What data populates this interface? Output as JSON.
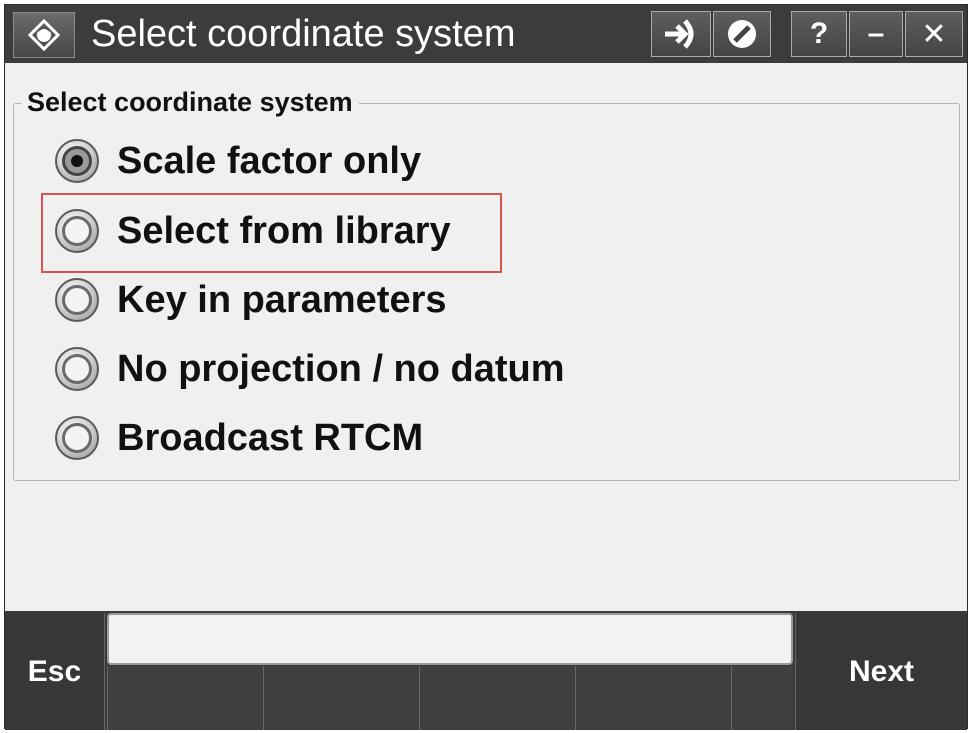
{
  "window": {
    "title": "Select coordinate system",
    "buttons": {
      "login_icon": "arrow-into-icon",
      "stop_icon": "stop-icon",
      "help": "?",
      "minimize": "–",
      "close": "✕"
    }
  },
  "group": {
    "title": "Select coordinate system",
    "options": [
      {
        "label": "Scale factor only",
        "checked": true
      },
      {
        "label": "Select from library",
        "checked": false,
        "highlighted": true
      },
      {
        "label": "Key in parameters",
        "checked": false
      },
      {
        "label": "No projection / no datum",
        "checked": false
      },
      {
        "label": "Broadcast RTCM",
        "checked": false
      }
    ]
  },
  "softkeys": {
    "esc": "Esc",
    "next": "Next"
  },
  "colors": {
    "highlight": "#d9534f",
    "titlebar": "#3c3c3c",
    "content": "#f0f0f0"
  }
}
